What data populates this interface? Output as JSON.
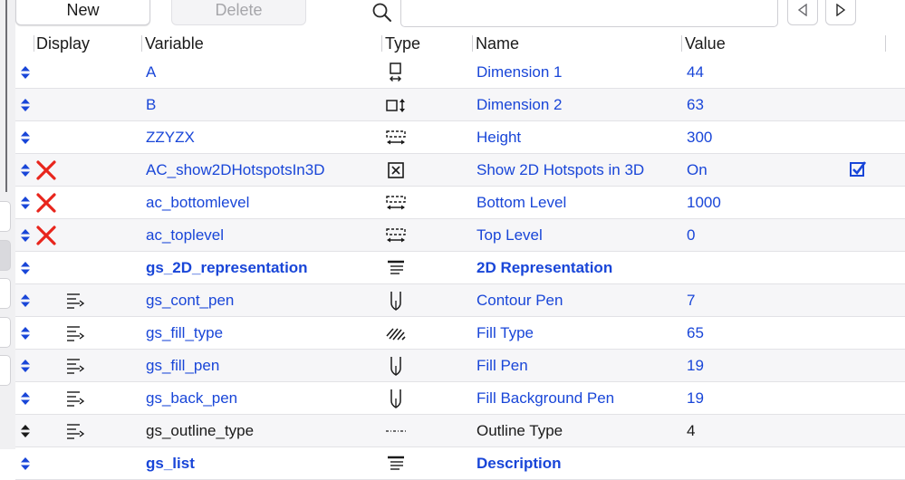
{
  "toolbar": {
    "new_label": "New",
    "delete_label": "Delete",
    "search": {
      "value": "",
      "placeholder": ""
    }
  },
  "columns": {
    "display": "Display",
    "variable": "Variable",
    "type": "Type",
    "name": "Name",
    "value": "Value"
  },
  "rows": [
    {
      "variable": "A",
      "type_icon": "dimension-horizontal-icon",
      "name": "Dimension 1",
      "value": "44",
      "display_icon": "",
      "color": "blue",
      "bold": false
    },
    {
      "variable": "B",
      "type_icon": "dimension-vertical-icon",
      "name": "Dimension 2",
      "value": "63",
      "display_icon": "",
      "color": "blue",
      "bold": false
    },
    {
      "variable": "ZZYZX",
      "type_icon": "length-icon",
      "name": "Height",
      "value": "300",
      "display_icon": "",
      "color": "blue",
      "bold": false
    },
    {
      "variable": "AC_show2DHotspotsIn3D",
      "type_icon": "boolean-icon",
      "name": "Show 2D Hotspots in 3D",
      "value": "On",
      "display_icon": "hidden-x-icon",
      "color": "blue",
      "bold": false,
      "checked": true
    },
    {
      "variable": "ac_bottomlevel",
      "type_icon": "length-icon",
      "name": "Bottom Level",
      "value": "1000",
      "display_icon": "hidden-x-icon",
      "color": "blue",
      "bold": false
    },
    {
      "variable": "ac_toplevel",
      "type_icon": "length-icon",
      "name": "Top Level",
      "value": "0",
      "display_icon": "hidden-x-icon",
      "color": "blue",
      "bold": false
    },
    {
      "variable": "gs_2D_representation",
      "type_icon": "title-icon",
      "name": "2D Representation",
      "value": "",
      "display_icon": "",
      "color": "blue",
      "bold": true
    },
    {
      "variable": "gs_cont_pen",
      "type_icon": "pen-icon",
      "name": "Contour Pen",
      "value": "7",
      "display_icon": "child-indent-icon",
      "color": "blue",
      "bold": false
    },
    {
      "variable": "gs_fill_type",
      "type_icon": "fill-type-icon",
      "name": "Fill Type",
      "value": "65",
      "display_icon": "child-indent-icon",
      "color": "blue",
      "bold": false
    },
    {
      "variable": "gs_fill_pen",
      "type_icon": "pen-icon",
      "name": "Fill Pen",
      "value": "19",
      "display_icon": "child-indent-icon",
      "color": "blue",
      "bold": false
    },
    {
      "variable": "gs_back_pen",
      "type_icon": "pen-icon",
      "name": "Fill Background Pen",
      "value": "19",
      "display_icon": "child-indent-icon",
      "color": "blue",
      "bold": false
    },
    {
      "variable": "gs_outline_type",
      "type_icon": "line-type-icon",
      "name": "Outline Type",
      "value": "4",
      "display_icon": "child-indent-icon",
      "color": "black",
      "bold": false
    },
    {
      "variable": "gs_list",
      "type_icon": "title-icon",
      "name": "Description",
      "value": "",
      "display_icon": "",
      "color": "blue",
      "bold": true
    }
  ],
  "colors": {
    "blue": "#1946d8",
    "red": "#e8251c",
    "header_text": "#1a1a1a"
  }
}
